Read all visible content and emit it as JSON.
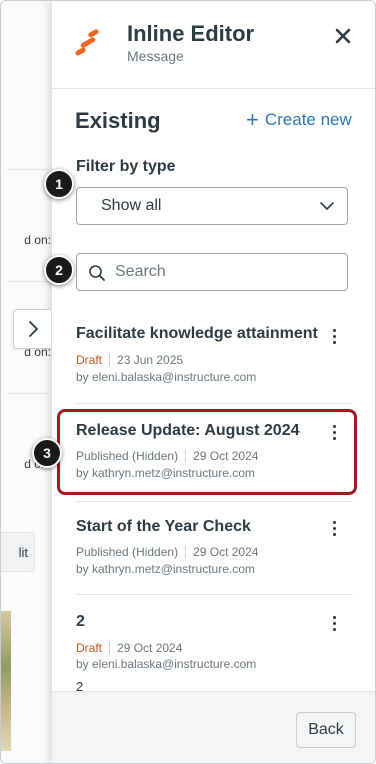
{
  "background": {
    "labels": [
      "d on:",
      "d on:",
      "d on:"
    ],
    "button_label": "lit"
  },
  "header": {
    "title": "Inline Editor",
    "subtitle": "Message",
    "logo_icon": "instructure-logo-icon",
    "close_icon": "close-icon"
  },
  "existing": {
    "heading": "Existing",
    "create_new_label": "Create new"
  },
  "filter": {
    "label": "Filter by type",
    "selected": "Show all"
  },
  "search": {
    "placeholder": "Search",
    "value": ""
  },
  "items": [
    {
      "title": "Facilitate knowledge attainment",
      "status": "Draft",
      "date": "23 Jun 2025",
      "by": "by eleni.balaska@instructure.com"
    },
    {
      "title": "Release Update: August 2024",
      "status": "Published (Hidden)",
      "date": "29 Oct 2024",
      "by": "by kathryn.metz@instructure.com"
    },
    {
      "title": "Start of the Year Check",
      "status": "Published (Hidden)",
      "date": "29 Oct 2024",
      "by": "by kathryn.metz@instructure.com"
    },
    {
      "title": "2",
      "status": "Draft",
      "date": "29 Oct 2024",
      "by": "by eleni.balaska@instructure.com",
      "extra": "2"
    }
  ],
  "callouts": [
    "1",
    "2",
    "3"
  ],
  "footer": {
    "back_label": "Back"
  },
  "colors": {
    "accent": "#2b7abc",
    "draft": "#c75a17",
    "highlight": "#9d1c24",
    "logo": "#f26522"
  }
}
